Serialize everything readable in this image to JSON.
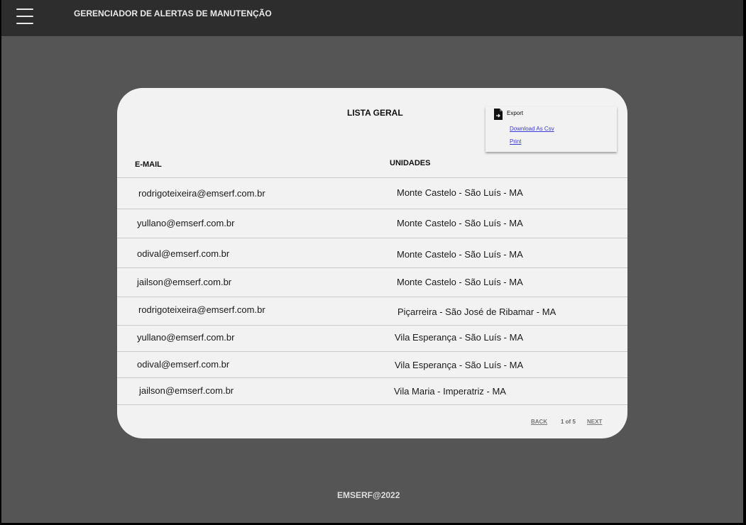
{
  "header": {
    "title": "GERENCIADOR DE ALERTAS DE MANUTENÇÃO",
    "menu_icon": "hamburger-menu-icon"
  },
  "card": {
    "title": "LISTA GERAL",
    "export": {
      "label": "Export",
      "icon": "document-export-icon",
      "download_csv": "Download As Csv",
      "print": "Print"
    },
    "columns": {
      "email": "E-MAIL",
      "units": "UNIDADES"
    },
    "rows": [
      {
        "email": "rodrigoteixeira@emserf.com.br",
        "unit": "Monte Castelo - São Luís - MA"
      },
      {
        "email": "yullano@emserf.com.br",
        "unit": "Monte Castelo - São Luís - MA"
      },
      {
        "email": "odival@emserf.com.br",
        "unit": "Monte Castelo - São Luís - MA"
      },
      {
        "email": "jailson@emserf.com.br",
        "unit": "Monte Castelo - São Luís - MA"
      },
      {
        "email": "rodrigoteixeira@emserf.com.br",
        "unit": "Piçarreira - São José de Ribamar - MA"
      },
      {
        "email": "yullano@emserf.com.br",
        "unit": "Vila Esperança - São Luís - MA"
      },
      {
        "email": "odival@emserf.com.br",
        "unit": "Vila Esperança - São Luís - MA"
      },
      {
        "email": "jailson@emserf.com.br",
        "unit": "Vila Maria - Imperatriz - MA"
      }
    ],
    "pagination": {
      "back": "BACK",
      "info": "1 of 5",
      "next": "NEXT"
    }
  },
  "footer": {
    "text": "EMSERF@2022"
  },
  "colors": {
    "background": "#555555",
    "topbar": "#2d2d2d",
    "card": "#f2f2f2",
    "link": "#3a3ad8"
  }
}
